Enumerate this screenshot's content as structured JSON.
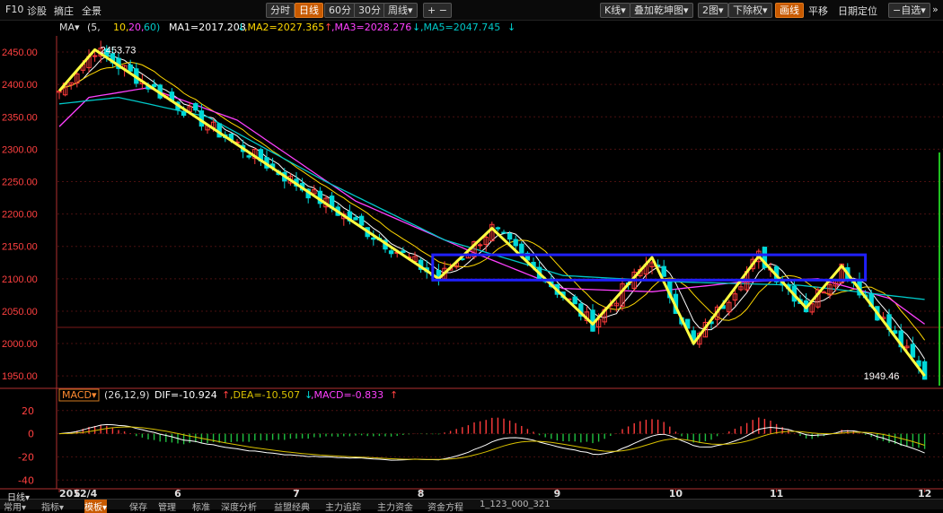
{
  "toolbar": {
    "left": [
      "F10",
      "诊股",
      "摘庄",
      "全景"
    ],
    "periods": [
      {
        "label": "分时",
        "active": false
      },
      {
        "label": "日线",
        "active": true
      },
      {
        "label": "60分",
        "active": false
      },
      {
        "label": "30分",
        "active": false
      },
      {
        "label": "周线▾",
        "active": false
      },
      {
        "label": "+  −",
        "active": false
      }
    ],
    "right": [
      {
        "label": "K线▾",
        "active": false
      },
      {
        "label": "叠加乾坤图▾",
        "active": false
      },
      {
        "label": "2图▾",
        "active": false
      },
      {
        "label": "下除权▾",
        "active": false
      },
      {
        "label": "画线",
        "active": true
      },
      {
        "label": "平移",
        "active": false
      },
      {
        "label": "日期定位",
        "active": false
      },
      {
        "label": "−自选▾",
        "active": false
      },
      {
        "label": "»",
        "active": false
      }
    ]
  },
  "ma_legend": {
    "label": "MA▾",
    "params_open": "(5,",
    "p10": "10,",
    "p20": "20,",
    "p60": "60)",
    "ma1": "MA1=2017.208",
    "ma1_arrow": "↓",
    "ma2": ",MA2=2027.365",
    "ma2_arrow": "↑",
    "ma3": ",MA3=2028.276",
    "ma3_arrow": "↓",
    "ma5": ",MA5=2047.745",
    "ma5_arrow": "↓"
  },
  "macd_legend": {
    "label": "MACD▾",
    "params": "(26,12,9)",
    "dif": "DIF=-10.924",
    "dif_arrow": "↑",
    "dea": ",DEA=-10.507",
    "dea_arrow": "↓",
    "macd": ",MACD=-0.833",
    "macd_arrow": "↑"
  },
  "bottombar": {
    "period": "日线▾",
    "tabs": [
      "常用▾",
      "指标▾",
      "模板▾",
      "保存",
      "管理",
      "标准",
      "深度分析",
      "益盟经典",
      "主力追踪",
      "主力资金",
      "资金方程",
      "1_123_000_321"
    ],
    "active_tab": "模板▾"
  },
  "colors": {
    "up": "#ff3b3b",
    "down": "#00d8d8",
    "ma1": "#ffffff",
    "ma2": "#ffd800",
    "ma3": "#ff40ff",
    "ma5": "#00c8c8",
    "trend_lines": "#ffff40",
    "box": "#2020ff",
    "axis_text": "#ff4040",
    "macd_dif": "#ffffff",
    "macd_dea": "#d8c000"
  },
  "chart_data": {
    "type": "candlestick",
    "title": "",
    "y_ticks": [
      2450,
      2400,
      2350,
      2300,
      2250,
      2200,
      2150,
      2100,
      2050,
      2000,
      1950
    ],
    "y_tick_labels": [
      "2450.00",
      "2400.00",
      "2350.00",
      "2300.00",
      "2250.00",
      "2200.00",
      "2150.00",
      "2100.00",
      "2050.00",
      "2000.00",
      "1950.00"
    ],
    "ylim": [
      1935,
      2475
    ],
    "x_tick_labels": [
      {
        "i": 0,
        "label": "2012/4"
      },
      {
        "i": 3,
        "label": "5"
      },
      {
        "i": 20,
        "label": "6"
      },
      {
        "i": 40,
        "label": "7"
      },
      {
        "i": 61,
        "label": "8"
      },
      {
        "i": 84,
        "label": "9"
      },
      {
        "i": 104,
        "label": "10"
      },
      {
        "i": 121,
        "label": "11"
      },
      {
        "i": 146,
        "label": "12"
      }
    ],
    "annotations": {
      "high_label": "2453.73",
      "low_label": "1949.46"
    },
    "zigzag": [
      [
        0,
        2390
      ],
      [
        6,
        2453.73
      ],
      [
        64,
        2100
      ],
      [
        73,
        2178
      ],
      [
        90,
        2030
      ],
      [
        100,
        2133
      ],
      [
        107,
        2000
      ],
      [
        118,
        2135
      ],
      [
        126,
        2055
      ],
      [
        132,
        2120
      ],
      [
        146,
        1950
      ]
    ],
    "consolidation_box": {
      "i_start": 63,
      "i_end": 136,
      "y_top": 2137,
      "y_bottom": 2098
    },
    "reference_level": 2025,
    "ma_anchors": {
      "ma5": [
        [
          0,
          2370
        ],
        [
          10,
          2380
        ],
        [
          25,
          2350
        ],
        [
          45,
          2250
        ],
        [
          65,
          2160
        ],
        [
          85,
          2105
        ],
        [
          105,
          2095
        ],
        [
          125,
          2090
        ],
        [
          146,
          2068
        ]
      ],
      "ma20": [
        [
          0,
          2335
        ],
        [
          5,
          2380
        ],
        [
          15,
          2395
        ],
        [
          30,
          2345
        ],
        [
          50,
          2220
        ],
        [
          70,
          2140
        ],
        [
          85,
          2085
        ],
        [
          100,
          2080
        ],
        [
          115,
          2095
        ],
        [
          128,
          2100
        ],
        [
          140,
          2070
        ],
        [
          146,
          2030
        ]
      ]
    },
    "macd": {
      "y_ticks": [
        20,
        0,
        -20,
        -40
      ],
      "ylim": [
        -46,
        26
      ]
    }
  }
}
